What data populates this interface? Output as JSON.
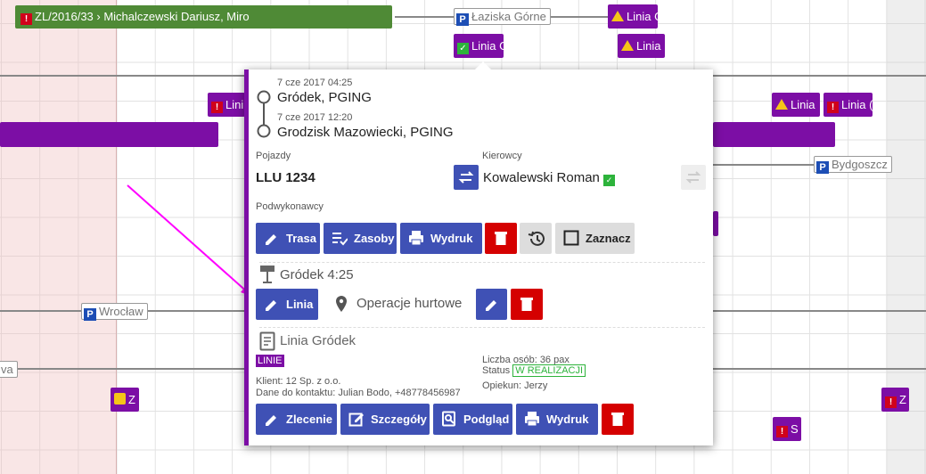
{
  "order_bar": {
    "label": "ZL/2016/33 › Michalczewski Dariusz, Miro"
  },
  "places": {
    "laziska": "Łaziska Górne",
    "bydgoszcz": "Bydgoszcz",
    "wroclaw": "Wrocław",
    "left_cut": "va"
  },
  "chips": {
    "linia_top_warn": "Linia G",
    "linia_green": "Linia G",
    "linia_warn2": "Linia",
    "linia_left": "Lini",
    "linia_right_warn": "Linia",
    "linia_right_red": "Linia (",
    "z_left": "Z",
    "z_right": "Z",
    "s_right": "S"
  },
  "popup": {
    "route": [
      {
        "time": "7 cze 2017 04:25",
        "place": "Gródek, PGING"
      },
      {
        "time": "7 cze 2017 12:20",
        "place": "Grodzisk Mazowiecki, PGING"
      }
    ],
    "vehicles_label": "Pojazdy",
    "vehicle": "LLU 1234",
    "drivers_label": "Kierowcy",
    "driver": "Kowalewski Roman",
    "subcontractors_label": "Podwykonawcy",
    "buttons": {
      "route": "Trasa",
      "resources": "Zasoby",
      "print": "Wydruk",
      "select": "Zaznacz"
    },
    "stop_title": "Gródek 4:25",
    "stop_line_button": "Linia",
    "operation": "Operacje hurtowe",
    "line_title": "Linia Gródek",
    "line_badge": "LINIE",
    "client": "Klient: 12 Sp. z o.o.",
    "contact": "Dane do kontaktu: Julian Bodo, +48778456987",
    "persons": "Liczba osób: 36 pax",
    "status_label": "Status",
    "status_value": "W REALIZACJI",
    "guardian": "Opiekun: Jerzy",
    "bottom_buttons": {
      "order": "Zlecenie",
      "details": "Szczegóły",
      "preview": "Podgląd",
      "print": "Wydruk"
    }
  },
  "colors": {
    "purple": "#7c0ea5",
    "blue_btn": "#3f51b5",
    "red_btn": "#d50000",
    "green_bar": "#4f8a36",
    "arrow": "#ff00ff"
  }
}
